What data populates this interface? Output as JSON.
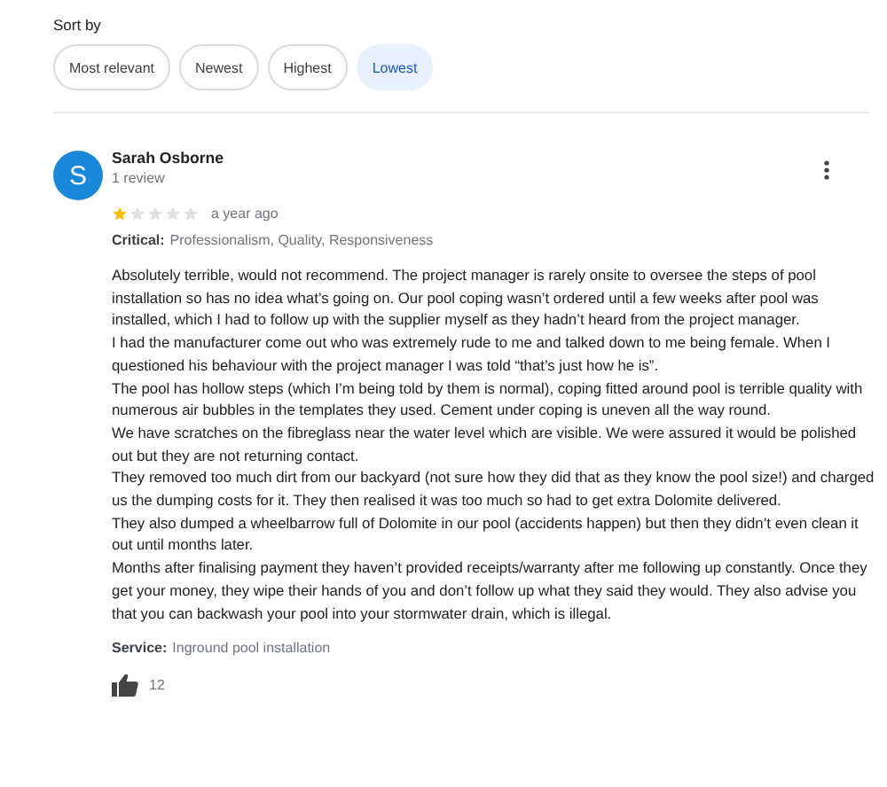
{
  "sort": {
    "label": "Sort by",
    "options": [
      {
        "label": "Most relevant",
        "selected": false
      },
      {
        "label": "Newest",
        "selected": false
      },
      {
        "label": "Highest",
        "selected": false
      },
      {
        "label": "Lowest",
        "selected": true
      }
    ]
  },
  "review": {
    "avatar_letter": "S",
    "author": "Sarah Osborne",
    "author_meta": "1 review",
    "stars": 1,
    "time": "a year ago",
    "critical_label": "Critical:",
    "critical_value": "Professionalism, Quality, Responsiveness",
    "paragraphs": [
      "Absolutely terrible, would not recommend. The project manager is rarely onsite to oversee the steps of pool installation so has no idea what’s going on. Our pool coping wasn’t ordered until a few weeks after pool was installed, which I had to follow up with the supplier myself as they hadn’t heard from the project manager.",
      "I had the manufacturer come out who was extremely rude to me and talked down to me being female. When I questioned his behaviour with the project manager I was told “that’s just how he is”.",
      "The pool has hollow steps (which I’m being told by them is normal), coping fitted around pool is terrible quality with numerous air bubbles in the templates they used. Cement under coping is uneven all the way round.",
      "We have scratches on the fibreglass near the water level which are visible. We were assured it would be polished out but they are not returning contact.",
      "They removed too much dirt from our backyard (not sure how they did that as they know the pool size!) and charged us the dumping costs for it. They then realised it was too much so had to get extra Dolomite delivered.",
      "They also dumped a wheelbarrow full of Dolomite in our pool (accidents happen) but then they didn’t even clean it out until months later.",
      "Months after finalising payment they haven’t provided receipts/warranty after me following up constantly. Once they get your money, they wipe their hands of you and don’t follow up what they said they would. They also advise you that you can backwash your pool into your stormwater drain, which is illegal."
    ],
    "service_label": "Service:",
    "service_value": "Inground pool installation",
    "likes": "12"
  }
}
